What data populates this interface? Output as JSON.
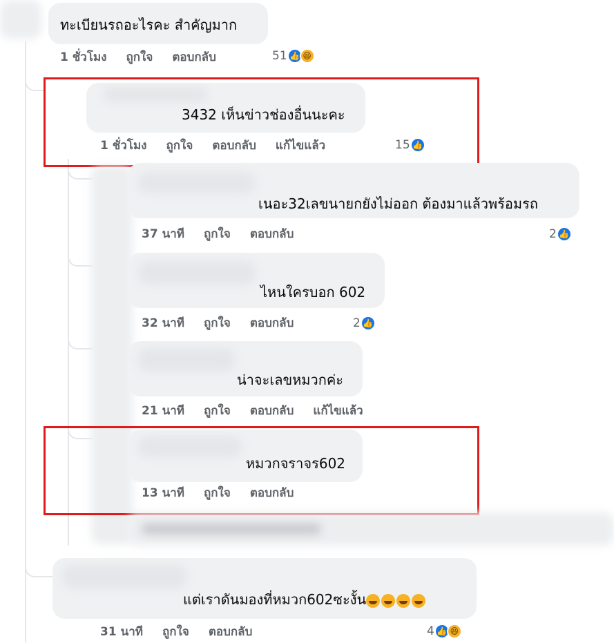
{
  "comments": [
    {
      "text": "ทะเบียนรถอะไรคะ สำคัญมาก",
      "time": "1 ชั่วโมง",
      "like": "ถูกใจ",
      "reply": "ตอบกลับ",
      "edited": "",
      "count": "51"
    },
    {
      "text": "3432 เห็นข่าวช่องอื่นนะคะ",
      "time": "1 ชั่วโมง",
      "like": "ถูกใจ",
      "reply": "ตอบกลับ",
      "edited": "แก้ไขแล้ว",
      "count": "15"
    },
    {
      "text": "เนอะ32เลขนายกยังไม่ออก ต้องมาแล้วพร้อมรถ",
      "time": "37 นาที",
      "like": "ถูกใจ",
      "reply": "ตอบกลับ",
      "edited": "",
      "count": "2"
    },
    {
      "text": "ไหนใครบอก 602",
      "time": "32 นาที",
      "like": "ถูกใจ",
      "reply": "ตอบกลับ",
      "edited": "",
      "count": "2"
    },
    {
      "text": "น่าจะเลขหมวกค่ะ",
      "time": "21 นาที",
      "like": "ถูกใจ",
      "reply": "ตอบกลับ",
      "edited": "แก้ไขแล้ว",
      "count": ""
    },
    {
      "text": "หมวกจราจร602",
      "time": "13 นาที",
      "like": "ถูกใจ",
      "reply": "ตอบกลับ",
      "edited": "",
      "count": ""
    },
    {
      "text": "แต่เราดันมองที่หมวก602ซะงั้น",
      "time": "31 นาที",
      "like": "ถูกใจ",
      "reply": "ตอบกลับ",
      "edited": "",
      "count": "4"
    }
  ],
  "icons": {
    "like": "like-reaction-icon",
    "haha": "haha-reaction-icon",
    "laugh_emoji": "rofl-emoji"
  },
  "colors": {
    "highlight": "#e01b1b",
    "like_blue": "#1b74e4",
    "bubble": "#eff1f3",
    "meta": "#5f6368"
  }
}
